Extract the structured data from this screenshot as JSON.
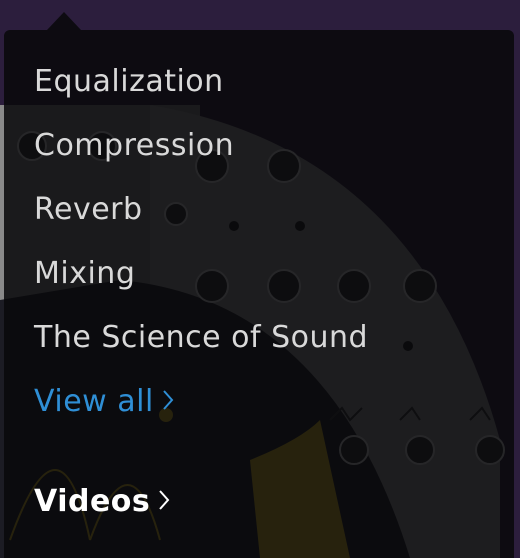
{
  "menu": {
    "items": [
      {
        "label": "Equalization"
      },
      {
        "label": "Compression"
      },
      {
        "label": "Reverb"
      },
      {
        "label": "Mixing"
      },
      {
        "label": "The Science of Sound"
      }
    ],
    "view_all_label": "View all",
    "videos_label": "Videos"
  },
  "colors": {
    "link_blue": "#2f8fd6",
    "item_text": "#d9d9d9",
    "panel_bg": "#08080a",
    "accent_yellow": "#e0c020",
    "page_purple": "#2c1e3d"
  }
}
